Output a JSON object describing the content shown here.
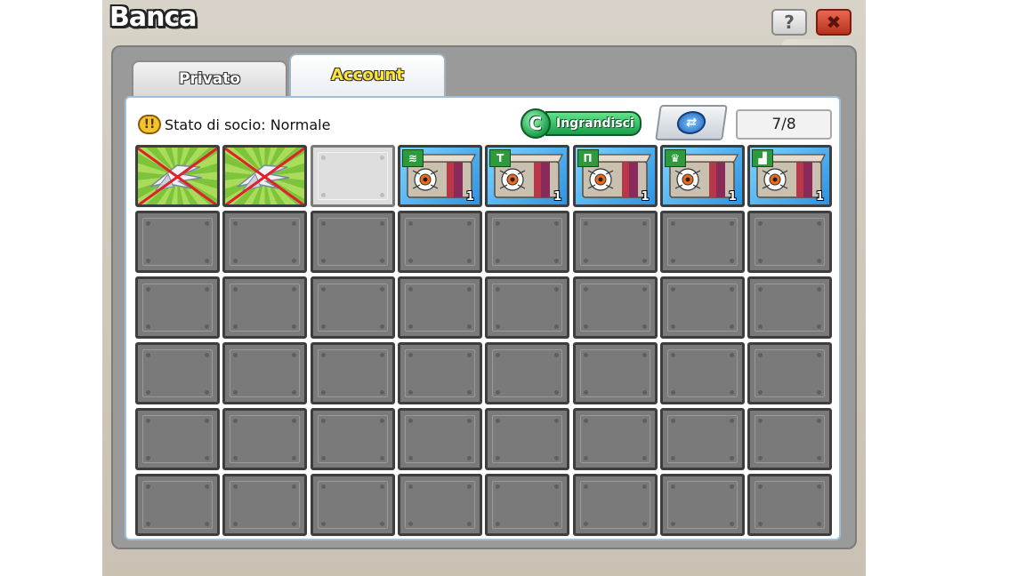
{
  "window": {
    "title": "Banca",
    "help_label": "?",
    "close_label": "✖"
  },
  "tabs": [
    {
      "label": "Privato",
      "active": false
    },
    {
      "label": "Account",
      "active": true
    }
  ],
  "status": {
    "label": "Stato di socio: Normale",
    "icon": "warning-icon"
  },
  "toolbar": {
    "enlarge_label": "Ingrandisci",
    "enlarge_icon_letter": "C",
    "swap_icon": "swap-icon"
  },
  "capacity": {
    "text": "7/8"
  },
  "grid": {
    "columns": 8,
    "rows": 6,
    "slots": [
      {
        "kind": "green",
        "item": "wings-item",
        "crossed": true
      },
      {
        "kind": "green",
        "item": "wings-item",
        "crossed": true
      },
      {
        "kind": "light",
        "item": null
      },
      {
        "kind": "blue",
        "item": "gift-box",
        "badge": "hair",
        "qty": "1"
      },
      {
        "kind": "blue",
        "item": "gift-box",
        "badge": "shirt",
        "qty": "1"
      },
      {
        "kind": "blue",
        "item": "gift-box",
        "badge": "pants",
        "qty": "1"
      },
      {
        "kind": "blue",
        "item": "gift-box",
        "badge": "crown",
        "qty": "1"
      },
      {
        "kind": "blue",
        "item": "gift-box",
        "badge": "shoe",
        "qty": "1"
      }
    ]
  },
  "colors": {
    "panel_border": "#9fc0d8",
    "tab_active_text": "#ffe534",
    "cross_mark": "#e0202a"
  }
}
